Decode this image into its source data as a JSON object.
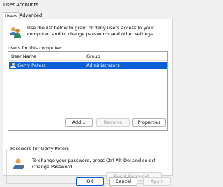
{
  "window": {
    "title": "User Accounts"
  },
  "tabs": [
    {
      "label": "Users"
    },
    {
      "label": "Advanced"
    }
  ],
  "intro": {
    "text": "Use the list below to grant or deny users access to your computer, and to change passwords and other settings."
  },
  "users": {
    "label": "Users for this computer:",
    "columns": [
      "User Name",
      "Group"
    ],
    "rows": [
      {
        "name": "Gerry Peters",
        "group": "Administrators"
      }
    ],
    "buttons": {
      "add": "Add...",
      "remove": "Remove",
      "properties": "Properties"
    }
  },
  "password": {
    "group_label": "Password for Gerry Peters",
    "text": "To change your password, press Ctrl-Alt-Del and select Change Password.",
    "reset_label": "Reset Password..."
  },
  "dialog": {
    "ok": "OK",
    "cancel": "Cancel",
    "apply": "Apply"
  }
}
